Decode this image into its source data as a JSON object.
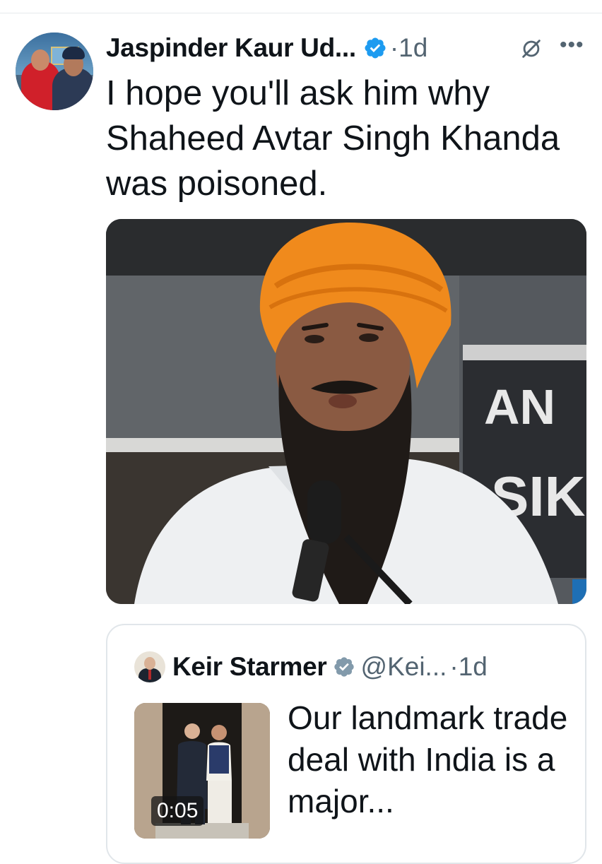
{
  "tweet": {
    "author": {
      "name": "Jaspinder Kaur Ud...",
      "verified": true
    },
    "separator": "·",
    "time": "1d",
    "text": "I hope you'll ask him why Shaheed Avtar Singh Khanda was poisoned.",
    "media": {
      "banner_text": [
        "AN",
        "SIK"
      ]
    },
    "icons": [
      "verified-badge-icon",
      "grok-icon",
      "more-options-icon"
    ]
  },
  "quoted_tweet": {
    "author": {
      "name": "Keir Starmer",
      "handle": "@Kei...",
      "verified": true
    },
    "separator": "·",
    "time": "1d",
    "video_duration": "0:05",
    "text": "Our landmark trade deal with India is a major..."
  },
  "colors": {
    "verified_blue": "#1d9bf0",
    "verified_gray": "#829aab",
    "secondary_text": "#536471",
    "turban_orange": "#f08a1c"
  }
}
